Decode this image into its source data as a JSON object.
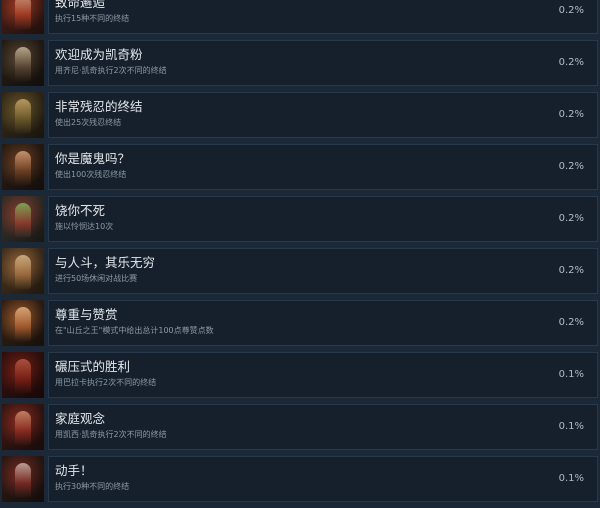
{
  "achievements": [
    {
      "name": "致命邂逅",
      "description": "执行15种不同的终结",
      "percent": "0.2%",
      "thumb_colors": [
        "#3a1a14",
        "#a33a22",
        "#d0a184"
      ]
    },
    {
      "name": "欢迎成为凯奇粉",
      "description": "用齐尼·凯奇执行2次不同的终结",
      "percent": "0.2%",
      "thumb_colors": [
        "#201913",
        "#5a4632",
        "#c7b79b"
      ]
    },
    {
      "name": "非常残忍的终结",
      "description": "使出25次残忍终结",
      "percent": "0.2%",
      "thumb_colors": [
        "#2e2416",
        "#6b5a2a",
        "#c8a46a"
      ]
    },
    {
      "name": "你是魔鬼吗？",
      "description": "使出100次残忍终结",
      "percent": "0.2%",
      "thumb_colors": [
        "#231812",
        "#6e4022",
        "#d8a07a"
      ]
    },
    {
      "name": "饶你不死",
      "description": "施以怜悯达10次",
      "percent": "0.2%",
      "thumb_colors": [
        "#2d2a24",
        "#8e3b2d",
        "#7fb35c"
      ]
    },
    {
      "name": "与人斗，其乐无穷",
      "description": "进行50场休闲对战比赛",
      "percent": "0.2%",
      "thumb_colors": [
        "#3a2a1a",
        "#9c6a3c",
        "#d6b48a"
      ]
    },
    {
      "name": "尊重与赞赏",
      "description": "在\"山丘之王\"模式中给出总计100点尊赞点数",
      "percent": "0.2%",
      "thumb_colors": [
        "#2a1c12",
        "#a35a2c",
        "#e2b584"
      ]
    },
    {
      "name": "碾压式的胜利",
      "description": "用巴拉卡执行2次不同的终结",
      "percent": "0.1%",
      "thumb_colors": [
        "#2a0e0c",
        "#7a1f16",
        "#b85a44"
      ]
    },
    {
      "name": "家庭观念",
      "description": "用凯西·凯奇执行2次不同的终结",
      "percent": "0.1%",
      "thumb_colors": [
        "#2e1410",
        "#8c2a20",
        "#cf8f6e"
      ]
    },
    {
      "name": "动手！",
      "description": "执行30种不同的终结",
      "percent": "0.1%",
      "thumb_colors": [
        "#241612",
        "#7a2a22",
        "#c9b3a8"
      ]
    }
  ]
}
